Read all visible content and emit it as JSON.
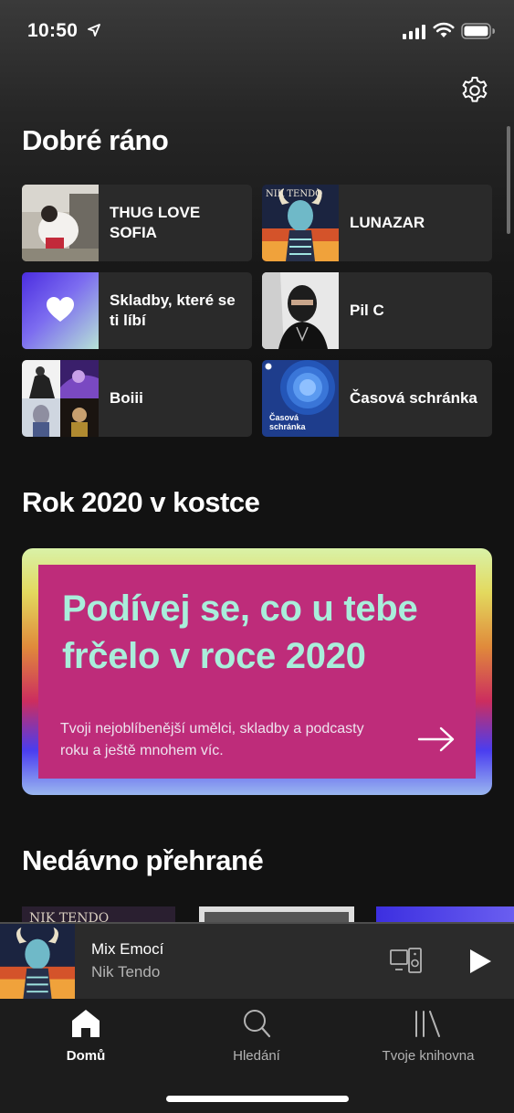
{
  "status": {
    "time": "10:50"
  },
  "home": {
    "greeting": "Dobré ráno",
    "shortcuts": [
      {
        "label": "THUG LOVE SOFIA"
      },
      {
        "label": "LUNAZAR"
      },
      {
        "label": "Skladby, které se ti líbí"
      },
      {
        "label": "Pil C"
      },
      {
        "label": "Boiii"
      },
      {
        "label": "Časová schránka",
        "art_text": "Časová schránka"
      }
    ],
    "wrapped_heading": "Rok 2020 v kostce",
    "wrapped_banner": {
      "title": "Podívej se, co u tebe frčelo v roce 2020",
      "subtitle": "Tvoji nejoblíbenější umělci, skladby a podcasty roku a ještě mnohem víc."
    },
    "recent_heading": "Nedávno přehrané"
  },
  "now_playing": {
    "title": "Mix Emocí",
    "artist": "Nik Tendo"
  },
  "tabs": [
    {
      "label": "Domů",
      "active": true
    },
    {
      "label": "Hledání",
      "active": false
    },
    {
      "label": "Tvoje knihovna",
      "active": false
    }
  ],
  "colors": {
    "banner_bg": "#be2c7a",
    "banner_title": "#a9eedb",
    "liked_gradient": [
      "#4b2de0",
      "#b7e3d6"
    ]
  }
}
